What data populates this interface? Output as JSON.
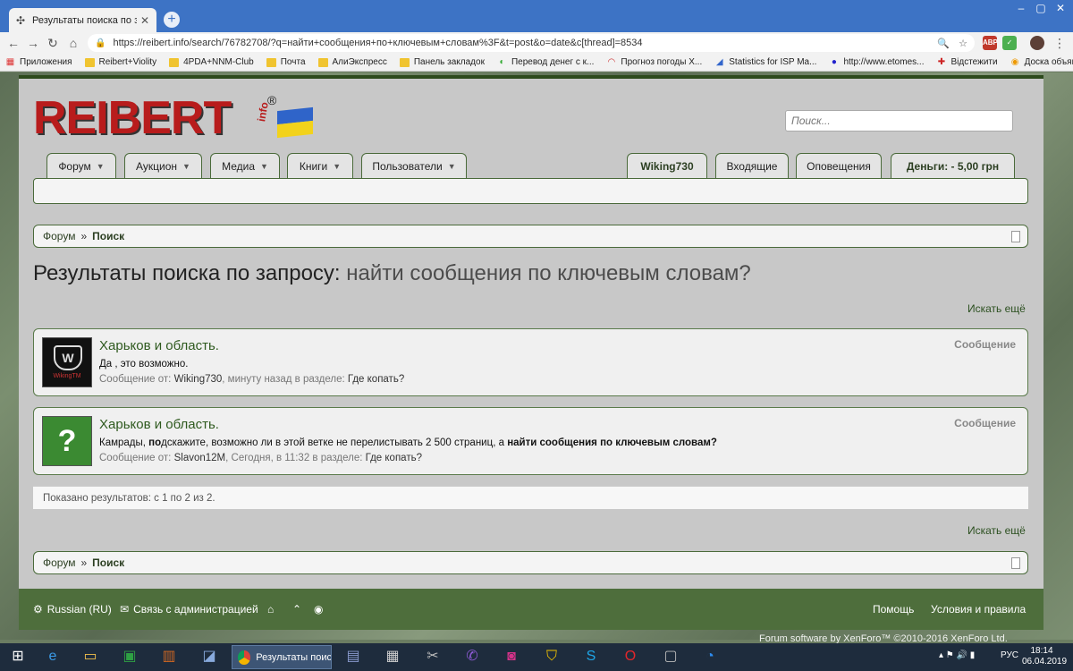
{
  "browser": {
    "tab_title": "Результаты поиска по запросу: найти сообщения по ключевым словам?",
    "url": "https://reibert.info/search/76782708/?q=найти+сообщения+по+ключевым+словам%3F&t=post&o=date&c[thread]=8534"
  },
  "bookmarks": [
    {
      "label": "Приложения",
      "icon": "apps-icon"
    },
    {
      "label": "Reibert+Violity",
      "icon": "folder-icon"
    },
    {
      "label": "4PDA+NNM-Club",
      "icon": "folder-icon"
    },
    {
      "label": "Почта",
      "icon": "folder-icon"
    },
    {
      "label": "АлиЭкспресс",
      "icon": "folder-icon"
    },
    {
      "label": "Панель закладок",
      "icon": "folder-icon"
    },
    {
      "label": "Перевод денег с к...",
      "icon": "money-icon"
    },
    {
      "label": "Прогноз погоды Х...",
      "icon": "weather-icon"
    },
    {
      "label": "Statistics for ISP Ma...",
      "icon": "chart-icon"
    },
    {
      "label": "http://www.etomes...",
      "icon": "circle-icon"
    },
    {
      "label": "Відстежити",
      "icon": "track-icon"
    },
    {
      "label": "Доска объявлений...",
      "icon": "olx-icon"
    }
  ],
  "site": {
    "logo_text": "REIBERT",
    "logo_sub": "info",
    "logo_reg": "®",
    "search_placeholder": "Поиск...",
    "nav_left": [
      "Форум",
      "Аукцион",
      "Медиа",
      "Книги",
      "Пользователи"
    ],
    "nav_right": [
      "Wiking730",
      "Входящие",
      "Оповещения",
      "Деньги: - 5,00 грн"
    ]
  },
  "breadcrumb": {
    "forum": "Форум",
    "separator": "»",
    "current": "Поиск"
  },
  "headline": {
    "prefix": "Результаты поиска по запросу:",
    "query": "найти сообщения по ключевым словам?"
  },
  "more_link": "Искать ещё",
  "results": [
    {
      "title": "Харьков и область.",
      "type": "Сообщение",
      "snippet_plain": "Да , это возможно.",
      "meta_prefix": "Сообщение от:",
      "user": "Wiking730",
      "meta_time": ", минуту назад в разделе:",
      "forum": "Где копать?",
      "avatar_caption": "WikingTM"
    },
    {
      "title": "Харьков и область.",
      "type": "Сообщение",
      "snippet_a": "Камрады,",
      "snippet_b": "по",
      "snippet_c": "дскажите, возможно ли в этой ветке не перелистывать 2 500 страниц, а",
      "snippet_d": "найти сообщения по ключевым словам?",
      "meta_prefix": "Сообщение от:",
      "user": "Slavon12M",
      "meta_time": ", Сегодня, в 11:32 в разделе:",
      "forum": "Где копать?",
      "avatar_mark": "?"
    }
  ],
  "shown_text": "Показано результатов: с 1 по 2 из 2.",
  "footer": {
    "language": "Russian (RU)",
    "contact": "Связь с администрацией",
    "help": "Помощь",
    "terms": "Условия и правила",
    "copyright": "Forum software by XenForo™ ©2010-2016 XenForo Ltd."
  },
  "taskbar": {
    "active_label": "Результаты поис...",
    "lang": "РУС",
    "time": "18:14",
    "date": "06.04.2019"
  }
}
